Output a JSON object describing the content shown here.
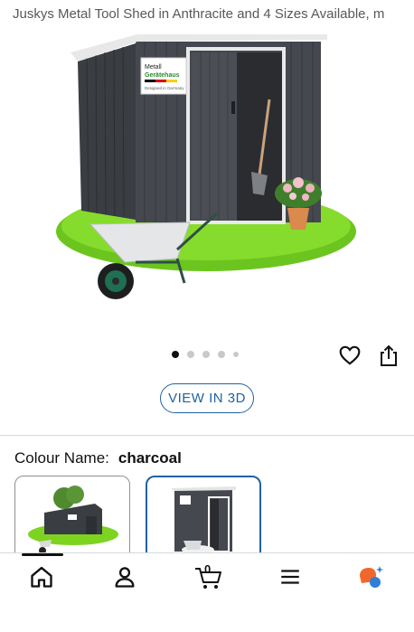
{
  "product": {
    "title": "Juskys Metal Tool Shed in Anthracite and 4 Sizes Available, m"
  },
  "gallery": {
    "image_label_line1": "Metall",
    "image_label_line2": "Gerätehaus",
    "image_label_line3": "Designed in Germany",
    "dot_count": 5,
    "active_dot": 0
  },
  "actions": {
    "view_in_3d": "VIEW IN 3D",
    "wishlist_icon": "heart-icon",
    "share_icon": "share-icon"
  },
  "variation": {
    "label": "Colour Name:",
    "value": "charcoal",
    "swatches": [
      "large-shed",
      "charcoal-shed"
    ],
    "selected_index": 1
  },
  "nav": {
    "cart_count": "0",
    "items": [
      "home",
      "account",
      "cart",
      "menu",
      "rufus"
    ]
  },
  "colors": {
    "link_blue": "#2162a1",
    "shed_gray": "#3a3d42",
    "grass_green": "#7ed321"
  }
}
